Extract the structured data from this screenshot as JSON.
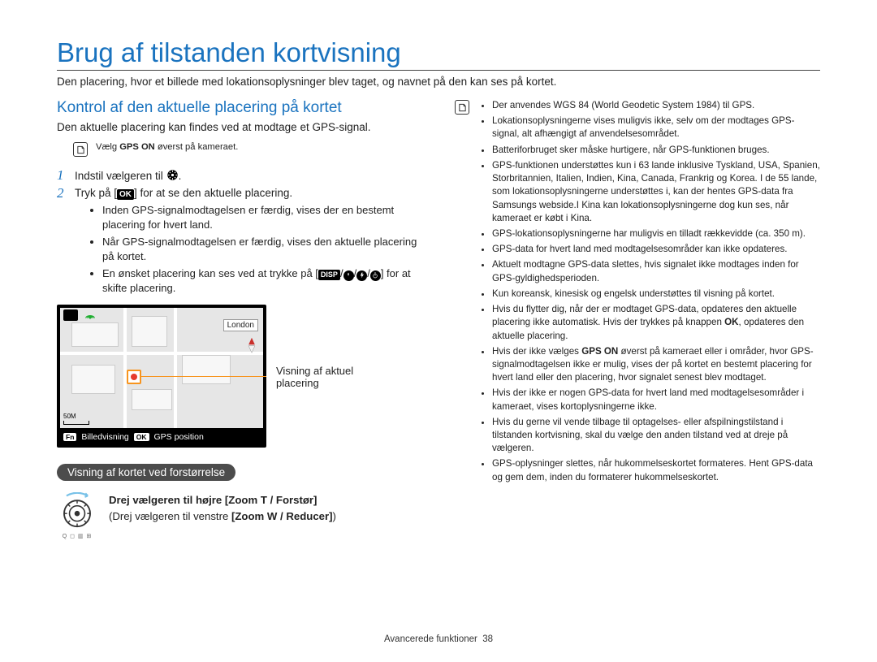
{
  "page": {
    "title": "Brug af tilstanden kortvisning",
    "intro": "Den placering, hvor et billede med lokationsoplysninger blev taget, og navnet på den kan ses på kortet."
  },
  "section": {
    "title": "Kontrol af den aktuelle placering på kortet",
    "intro": "Den aktuelle placering kan findes ved at modtage et GPS-signal."
  },
  "note": {
    "prefix": "Vælg ",
    "bold": "GPS ON",
    "suffix": " øverst på kameraet."
  },
  "steps": {
    "s1_text": "Indstil vælgeren til ",
    "s2_prefix": "Tryk på [",
    "s2_ok": "OK",
    "s2_suffix": "] for at se den aktuelle placering."
  },
  "bullets": {
    "b1": "Inden GPS-signalmodtagelsen er færdig, vises der en bestemt placering for hvert land.",
    "b2": "Når GPS-signalmodtagelsen er færdig, vises den aktuelle placering på kortet.",
    "b3_prefix": "En ønsket placering kan ses ved at trykke på [",
    "b3_disp": "DISP",
    "b3_suffix": "] for at skifte placering."
  },
  "map": {
    "city": "London",
    "scale": "50M",
    "bottom_left_label": "Billedvisning",
    "bottom_right_label": "GPS position",
    "fn_chip": "Fn",
    "ok_chip": "OK"
  },
  "callout": {
    "line1": "Visning af aktuel",
    "line2": "placering"
  },
  "zoom_heading": "Visning af kortet ved forstørrelse",
  "dial": {
    "line1_prefix": "Drej vælgeren til højre ",
    "line1_bold": "[Zoom T / Forstør]",
    "line2_prefix": "(Drej vælgeren til venstre ",
    "line2_bold": "[Zoom W / Reducer]",
    "line2_suffix": ")"
  },
  "right_notes": [
    "Der anvendes WGS 84 (World Geodetic System 1984) til GPS.",
    "Lokationsoplysningerne vises muligvis ikke, selv om der modtages GPS-signal, alt afhængigt af anvendelsesområdet.",
    "Batteriforbruget sker måske hurtigere, når GPS-funktionen bruges.",
    "GPS-funktionen understøttes kun i 63 lande inklusive Tyskland, USA, Spanien, Storbritannien, Italien, Indien, Kina, Canada, Frankrig og Korea. I de 55 lande, som lokationsoplysningerne understøttes i, kan der hentes GPS-data fra Samsungs webside.I Kina kan lokationsoplysningerne dog kun ses, når kameraet er købt i Kina.",
    "GPS-lokationsoplysningerne har muligvis en tilladt rækkevidde (ca. 350 m).",
    "GPS-data for hvert land med modtagelsesområder kan ikke opdateres.",
    "Aktuelt modtagne GPS-data slettes, hvis signalet ikke modtages inden for GPS-gyldighedsperioden.",
    "Kun koreansk, kinesisk og engelsk understøttes til visning på kortet."
  ],
  "right_notes2_a_prefix": "Hvis du flytter dig, når der er modtaget GPS-data, opdateres den aktuelle placering ikke automatisk. Hvis der trykkes på knappen ",
  "right_notes2_a_bold": "OK",
  "right_notes2_a_suffix": ", opdateres den aktuelle placering.",
  "right_notes2_b_prefix": "Hvis der ikke vælges ",
  "right_notes2_b_bold": "GPS ON",
  "right_notes2_b_suffix": " øverst på kameraet eller i områder, hvor GPS-signalmodtagelsen ikke er mulig, vises der på kortet en bestemt placering for hvert land eller den placering, hvor signalet senest blev modtaget.",
  "right_notes3": [
    "Hvis der ikke er nogen GPS-data for hvert land med modtagelsesområder i kameraet, vises kortoplysningerne ikke.",
    "Hvis du gerne vil vende tilbage til optagelses- eller afspilningstilstand i tilstanden kortvisning, skal du vælge den anden tilstand ved at dreje på vælgeren.",
    "GPS-oplysninger slettes, når hukommelseskortet formateres. Hent GPS-data og gem dem, inden du formaterer hukommelseskortet."
  ],
  "footer": {
    "label": "Avancerede funktioner",
    "page": "38"
  }
}
